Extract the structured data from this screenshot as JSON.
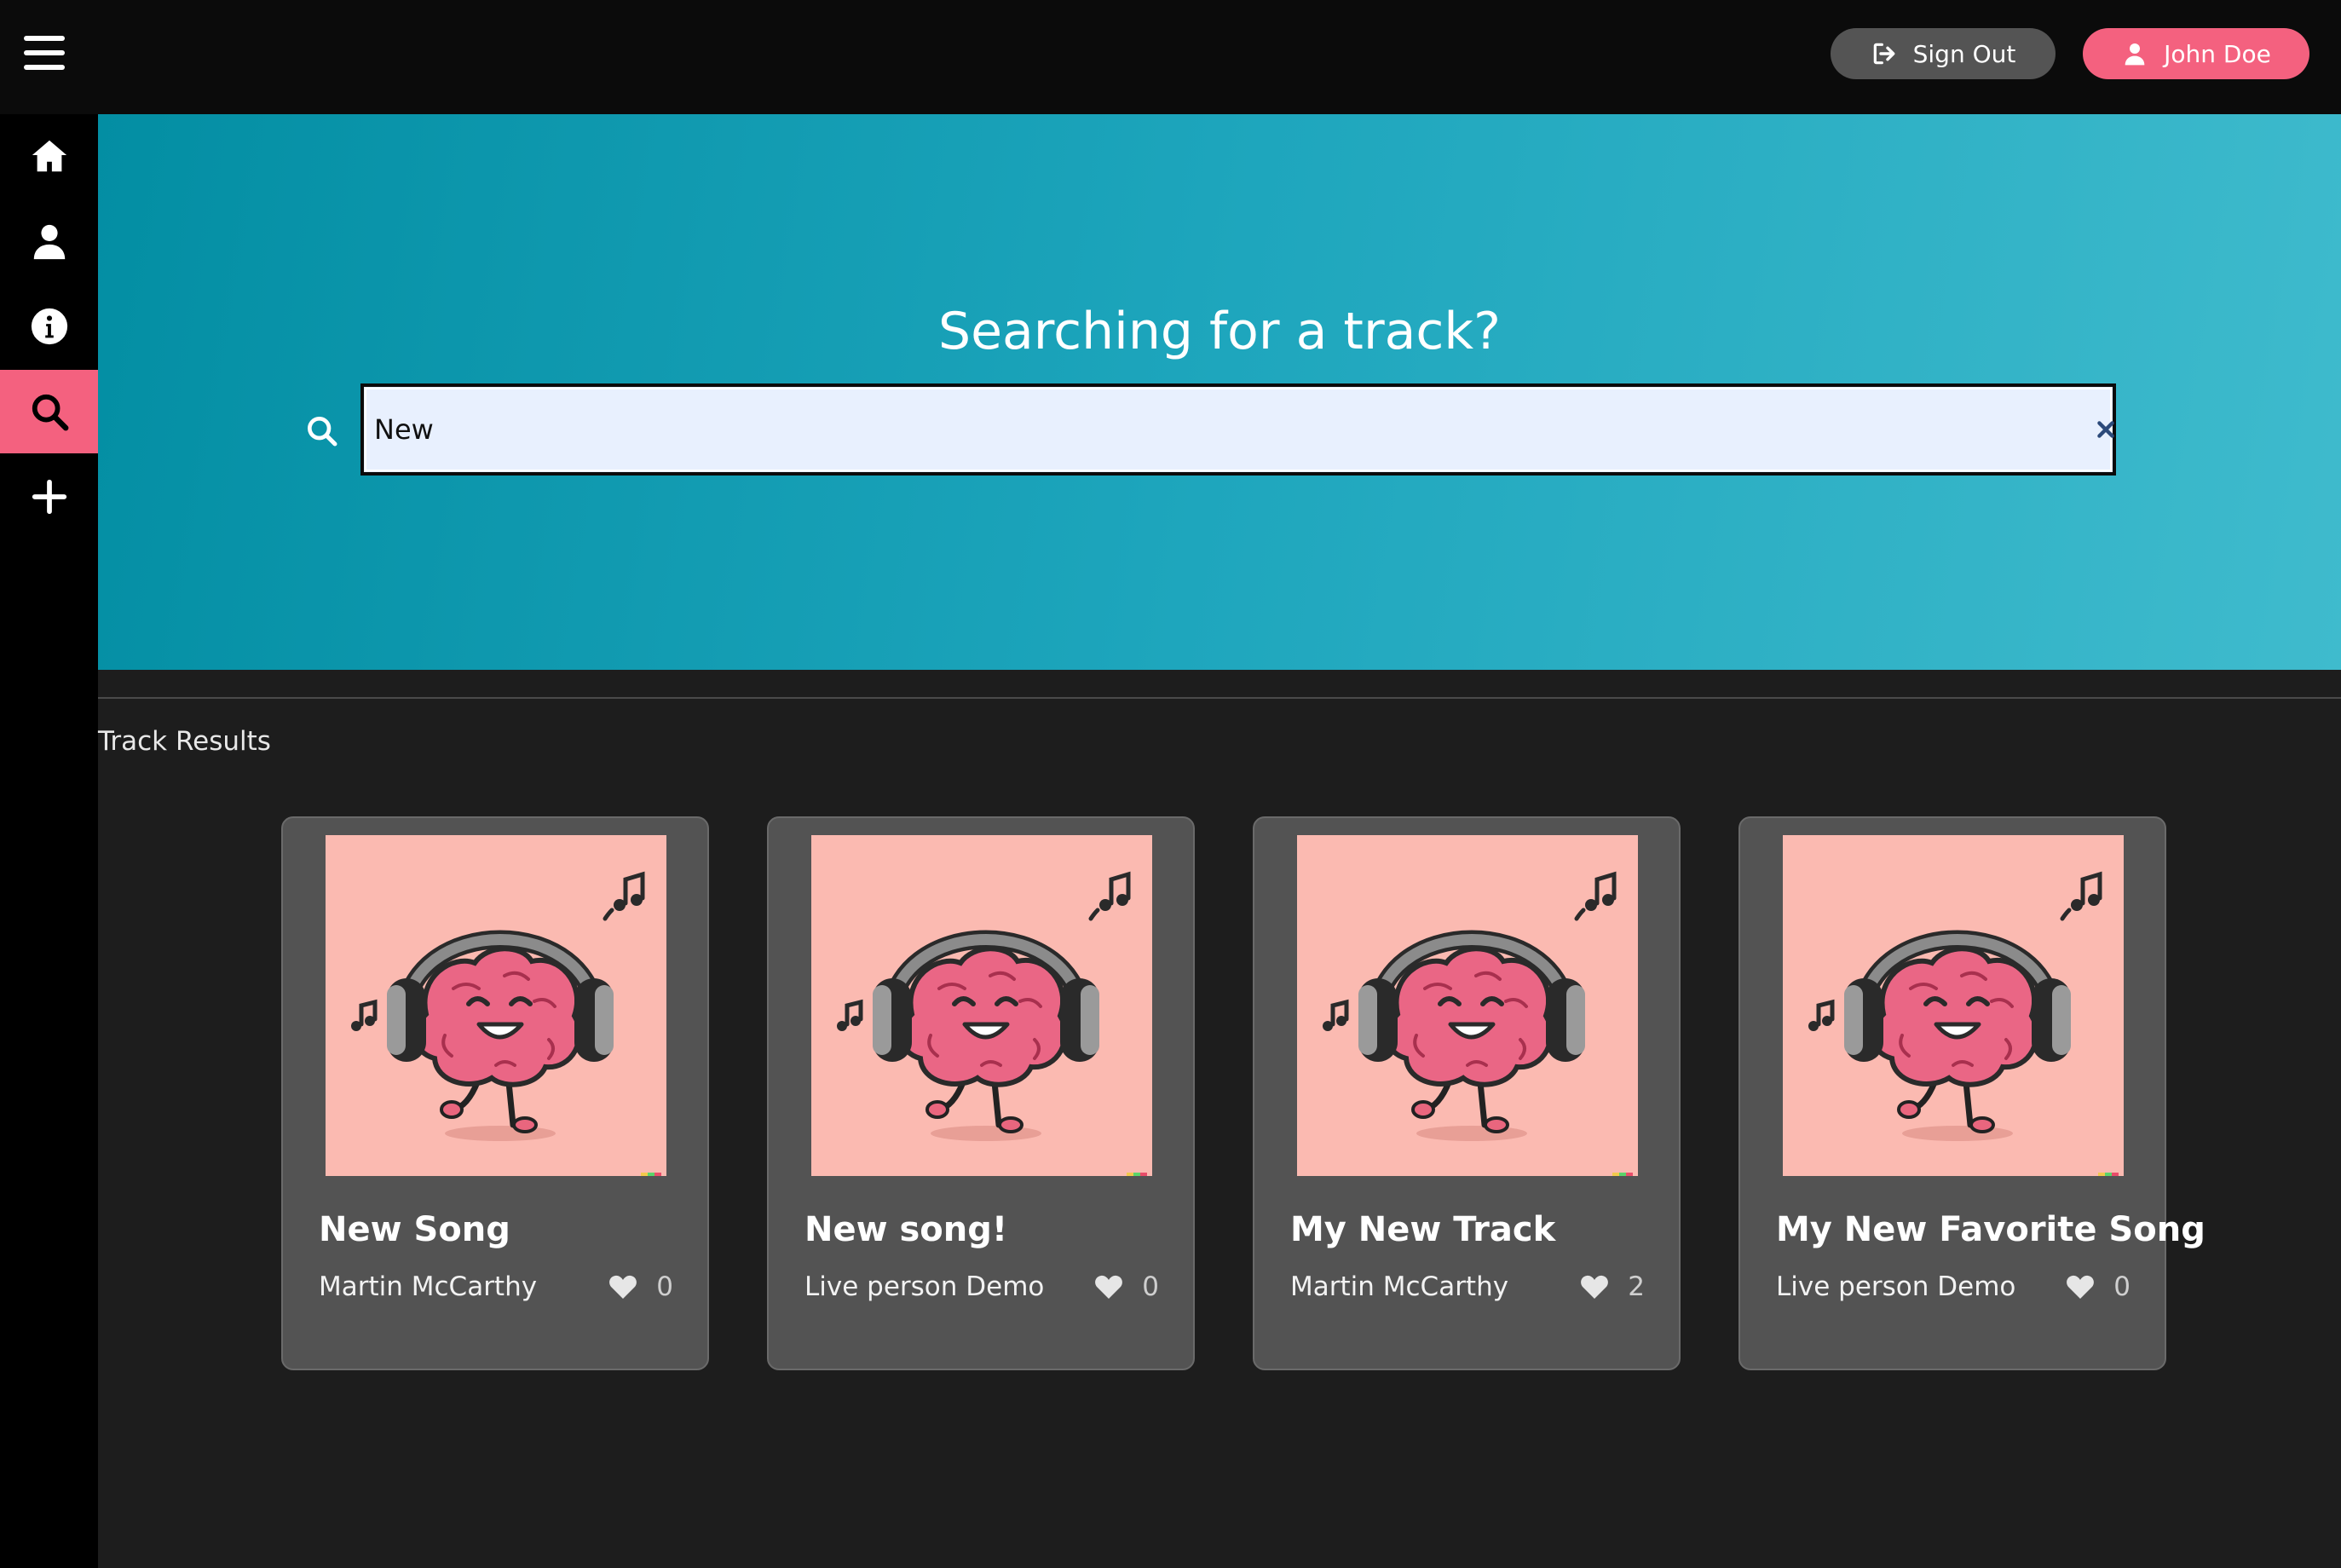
{
  "header": {
    "sign_out_label": "Sign Out",
    "user_label": "John Doe"
  },
  "sidebar": {
    "items": [
      {
        "name": "home",
        "icon": "home-icon"
      },
      {
        "name": "profile",
        "icon": "user-icon"
      },
      {
        "name": "about",
        "icon": "info-icon"
      },
      {
        "name": "search",
        "icon": "search-icon",
        "active": true
      },
      {
        "name": "add",
        "icon": "plus-icon"
      }
    ]
  },
  "search": {
    "heading": "Searching for a track?",
    "value": "New"
  },
  "results": {
    "label": "Track Results",
    "tracks": [
      {
        "title": "New Song",
        "artist": "Martin McCarthy",
        "likes": "0"
      },
      {
        "title": "New song!",
        "artist": "Live person Demo",
        "likes": "0"
      },
      {
        "title": "My New Track",
        "artist": "Martin McCarthy",
        "likes": "2"
      },
      {
        "title": "My New Favorite Song",
        "artist": "Live person Demo",
        "likes": "0"
      }
    ]
  },
  "colors": {
    "accent": "#f4617f",
    "hero_start": "#038ea3",
    "hero_end": "#3fbbcd",
    "card_bg": "#535353",
    "artwork_bg": "#fbbab1"
  }
}
